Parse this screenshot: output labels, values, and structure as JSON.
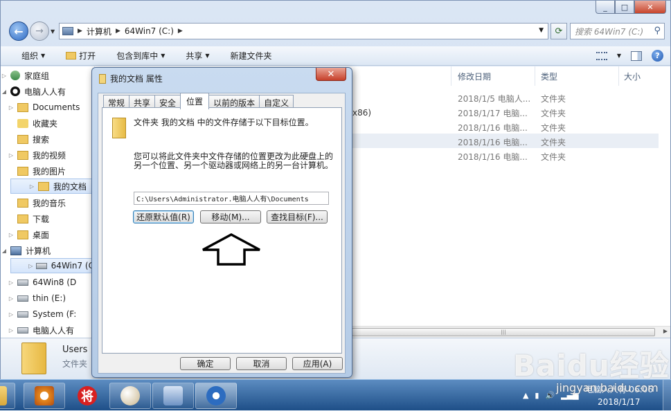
{
  "explorer": {
    "address_crumbs": [
      "计算机",
      "64Win7 (C:)"
    ],
    "search_placeholder": "搜索 64Win7 (C:)",
    "toolbar": {
      "organize": "组织",
      "open": "打开",
      "include_library": "包含到库中",
      "share": "共享",
      "new_folder": "新建文件夹"
    },
    "columns": {
      "date_modified": "修改日期",
      "type": "类型",
      "size": "大小"
    },
    "nav_items": [
      {
        "label": "家庭组",
        "icon": "homegroup-icon"
      },
      {
        "label": "电脑人人有",
        "icon": "user-icon"
      },
      {
        "label": "Documents",
        "icon": "folder-icon"
      },
      {
        "label": "收藏夹",
        "icon": "favorites-icon"
      },
      {
        "label": "搜索",
        "icon": "search-folder-icon"
      },
      {
        "label": "我的视频",
        "icon": "folder-icon"
      },
      {
        "label": "我的图片",
        "icon": "folder-icon"
      },
      {
        "label": "我的文档",
        "icon": "folder-icon"
      },
      {
        "label": "我的音乐",
        "icon": "folder-icon"
      },
      {
        "label": "下载",
        "icon": "folder-icon"
      },
      {
        "label": "桌面",
        "icon": "folder-icon"
      },
      {
        "label": "计算机",
        "icon": "computer-icon"
      },
      {
        "label": "64Win7 (C",
        "icon": "drive-icon"
      },
      {
        "label": "64Win8 (D",
        "icon": "drive-icon"
      },
      {
        "label": "thin (E:)",
        "icon": "drive-icon"
      },
      {
        "label": "System (F:",
        "icon": "drive-icon"
      },
      {
        "label": "电脑人人有",
        "icon": "drive-icon"
      }
    ],
    "file_fragment": "x86)",
    "files": [
      {
        "date": "2018/1/5 电脑人...",
        "type": "文件夹"
      },
      {
        "date": "2018/1/17 电脑...",
        "type": "文件夹"
      },
      {
        "date": "2018/1/16 电脑...",
        "type": "文件夹"
      },
      {
        "date": "2018/1/16 电脑...",
        "type": "文件夹"
      },
      {
        "date": "2018/1/16 电脑...",
        "type": "文件夹"
      }
    ],
    "details": {
      "name": "Users",
      "type": "文件夹"
    }
  },
  "dialog": {
    "title": "我的文档 属性",
    "tabs": [
      "常规",
      "共享",
      "安全",
      "位置",
      "以前的版本",
      "自定义"
    ],
    "active_tab": "位置",
    "info_text": "文件夹 我的文档 中的文件存储于以下目标位置。",
    "desc_text": "您可以将此文件夹中文件存储的位置更改为此硬盘上的另一个位置、另一个驱动器或网络上的另一台计算机。",
    "path": "C:\\Users\\Administrator.电脑人人有\\Documents",
    "buttons": {
      "restore": "还原默认值(R)",
      "move": "移动(M)...",
      "find_target": "查找目标(F)..."
    },
    "footer": {
      "ok": "确定",
      "cancel": "取消",
      "apply": "应用(A)"
    }
  },
  "taskbar": {
    "time": "06:06",
    "date": "2018/1/17",
    "tray_user": "电脑人人有"
  },
  "watermark": {
    "logo": "Baidu经验",
    "url": "jingyan.baidu.com"
  }
}
